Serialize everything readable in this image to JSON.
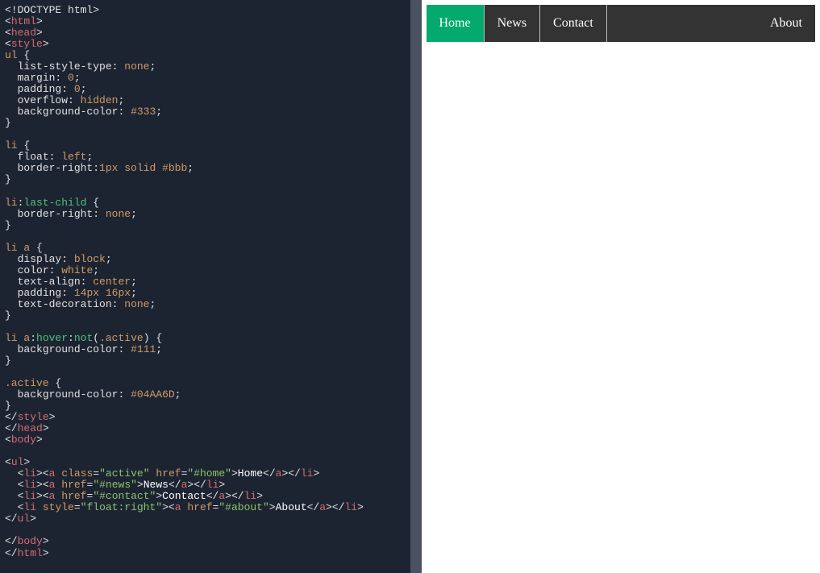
{
  "code": {
    "lines": [
      [
        [
          "tok-angle",
          "<!"
        ],
        [
          "tok-doctype",
          "DOCTYPE html"
        ],
        [
          "tok-angle",
          ">"
        ]
      ],
      [
        [
          "tok-angle",
          "<"
        ],
        [
          "tok-tag",
          "html"
        ],
        [
          "tok-angle",
          ">"
        ]
      ],
      [
        [
          "tok-angle",
          "<"
        ],
        [
          "tok-tag",
          "head"
        ],
        [
          "tok-angle",
          ">"
        ]
      ],
      [
        [
          "tok-angle",
          "<"
        ],
        [
          "tok-tag",
          "style"
        ],
        [
          "tok-angle",
          ">"
        ]
      ],
      [
        [
          "tok-sel",
          "ul"
        ],
        [
          "tok-text",
          " "
        ],
        [
          "tok-brace",
          "{"
        ]
      ],
      [
        [
          "tok-text",
          "  "
        ],
        [
          "tok-prop",
          "list-style-type"
        ],
        [
          "tok-punc",
          ":"
        ],
        [
          "tok-text",
          " "
        ],
        [
          "tok-val",
          "none"
        ],
        [
          "tok-punc",
          ";"
        ]
      ],
      [
        [
          "tok-text",
          "  "
        ],
        [
          "tok-prop",
          "margin"
        ],
        [
          "tok-punc",
          ":"
        ],
        [
          "tok-text",
          " "
        ],
        [
          "tok-val",
          "0"
        ],
        [
          "tok-punc",
          ";"
        ]
      ],
      [
        [
          "tok-text",
          "  "
        ],
        [
          "tok-prop",
          "padding"
        ],
        [
          "tok-punc",
          ":"
        ],
        [
          "tok-text",
          " "
        ],
        [
          "tok-val",
          "0"
        ],
        [
          "tok-punc",
          ";"
        ]
      ],
      [
        [
          "tok-text",
          "  "
        ],
        [
          "tok-prop",
          "overflow"
        ],
        [
          "tok-punc",
          ":"
        ],
        [
          "tok-text",
          " "
        ],
        [
          "tok-val",
          "hidden"
        ],
        [
          "tok-punc",
          ";"
        ]
      ],
      [
        [
          "tok-text",
          "  "
        ],
        [
          "tok-prop",
          "background-color"
        ],
        [
          "tok-punc",
          ":"
        ],
        [
          "tok-text",
          " "
        ],
        [
          "tok-hex",
          "#333"
        ],
        [
          "tok-punc",
          ";"
        ]
      ],
      [
        [
          "tok-brace",
          "}"
        ]
      ],
      [
        [
          "tok-text",
          ""
        ]
      ],
      [
        [
          "tok-sel",
          "li"
        ],
        [
          "tok-text",
          " "
        ],
        [
          "tok-brace",
          "{"
        ]
      ],
      [
        [
          "tok-text",
          "  "
        ],
        [
          "tok-prop",
          "float"
        ],
        [
          "tok-punc",
          ":"
        ],
        [
          "tok-text",
          " "
        ],
        [
          "tok-val",
          "left"
        ],
        [
          "tok-punc",
          ";"
        ]
      ],
      [
        [
          "tok-text",
          "  "
        ],
        [
          "tok-prop",
          "border-right"
        ],
        [
          "tok-punc",
          ":"
        ],
        [
          "tok-val",
          "1px solid "
        ],
        [
          "tok-hex",
          "#bbb"
        ],
        [
          "tok-punc",
          ";"
        ]
      ],
      [
        [
          "tok-brace",
          "}"
        ]
      ],
      [
        [
          "tok-text",
          ""
        ]
      ],
      [
        [
          "tok-sel",
          "li"
        ],
        [
          "tok-punc",
          ":"
        ],
        [
          "tok-pseudo",
          "last-child"
        ],
        [
          "tok-text",
          " "
        ],
        [
          "tok-brace",
          "{"
        ]
      ],
      [
        [
          "tok-text",
          "  "
        ],
        [
          "tok-prop",
          "border-right"
        ],
        [
          "tok-punc",
          ":"
        ],
        [
          "tok-text",
          " "
        ],
        [
          "tok-val",
          "none"
        ],
        [
          "tok-punc",
          ";"
        ]
      ],
      [
        [
          "tok-brace",
          "}"
        ]
      ],
      [
        [
          "tok-text",
          ""
        ]
      ],
      [
        [
          "tok-sel",
          "li a"
        ],
        [
          "tok-text",
          " "
        ],
        [
          "tok-brace",
          "{"
        ]
      ],
      [
        [
          "tok-text",
          "  "
        ],
        [
          "tok-prop",
          "display"
        ],
        [
          "tok-punc",
          ":"
        ],
        [
          "tok-text",
          " "
        ],
        [
          "tok-val",
          "block"
        ],
        [
          "tok-punc",
          ";"
        ]
      ],
      [
        [
          "tok-text",
          "  "
        ],
        [
          "tok-prop",
          "color"
        ],
        [
          "tok-punc",
          ":"
        ],
        [
          "tok-text",
          " "
        ],
        [
          "tok-val",
          "white"
        ],
        [
          "tok-punc",
          ";"
        ]
      ],
      [
        [
          "tok-text",
          "  "
        ],
        [
          "tok-prop",
          "text-align"
        ],
        [
          "tok-punc",
          ":"
        ],
        [
          "tok-text",
          " "
        ],
        [
          "tok-val",
          "center"
        ],
        [
          "tok-punc",
          ";"
        ]
      ],
      [
        [
          "tok-text",
          "  "
        ],
        [
          "tok-prop",
          "padding"
        ],
        [
          "tok-punc",
          ":"
        ],
        [
          "tok-text",
          " "
        ],
        [
          "tok-val",
          "14px 16px"
        ],
        [
          "tok-punc",
          ";"
        ]
      ],
      [
        [
          "tok-text",
          "  "
        ],
        [
          "tok-prop",
          "text-decoration"
        ],
        [
          "tok-punc",
          ":"
        ],
        [
          "tok-text",
          " "
        ],
        [
          "tok-val",
          "none"
        ],
        [
          "tok-punc",
          ";"
        ]
      ],
      [
        [
          "tok-brace",
          "}"
        ]
      ],
      [
        [
          "tok-text",
          ""
        ]
      ],
      [
        [
          "tok-sel",
          "li a"
        ],
        [
          "tok-punc",
          ":"
        ],
        [
          "tok-pseudo",
          "hover"
        ],
        [
          "tok-punc",
          ":"
        ],
        [
          "tok-pseudo",
          "not"
        ],
        [
          "tok-punc",
          "("
        ],
        [
          "tok-class",
          ".active"
        ],
        [
          "tok-punc",
          ")"
        ],
        [
          "tok-text",
          " "
        ],
        [
          "tok-brace",
          "{"
        ]
      ],
      [
        [
          "tok-text",
          "  "
        ],
        [
          "tok-prop",
          "background-color"
        ],
        [
          "tok-punc",
          ":"
        ],
        [
          "tok-text",
          " "
        ],
        [
          "tok-hex",
          "#111"
        ],
        [
          "tok-punc",
          ";"
        ]
      ],
      [
        [
          "tok-brace",
          "}"
        ]
      ],
      [
        [
          "tok-text",
          ""
        ]
      ],
      [
        [
          "tok-class",
          ".active"
        ],
        [
          "tok-text",
          " "
        ],
        [
          "tok-brace",
          "{"
        ]
      ],
      [
        [
          "tok-text",
          "  "
        ],
        [
          "tok-prop",
          "background-color"
        ],
        [
          "tok-punc",
          ":"
        ],
        [
          "tok-text",
          " "
        ],
        [
          "tok-hex",
          "#04AA6D"
        ],
        [
          "tok-punc",
          ";"
        ]
      ],
      [
        [
          "tok-brace",
          "}"
        ]
      ],
      [
        [
          "tok-angle",
          "</"
        ],
        [
          "tok-tag",
          "style"
        ],
        [
          "tok-angle",
          ">"
        ]
      ],
      [
        [
          "tok-angle",
          "</"
        ],
        [
          "tok-tag",
          "head"
        ],
        [
          "tok-angle",
          ">"
        ]
      ],
      [
        [
          "tok-angle",
          "<"
        ],
        [
          "tok-tag",
          "body"
        ],
        [
          "tok-angle",
          ">"
        ]
      ],
      [
        [
          "tok-text",
          ""
        ]
      ],
      [
        [
          "tok-angle",
          "<"
        ],
        [
          "tok-tag",
          "ul"
        ],
        [
          "tok-angle",
          ">"
        ]
      ],
      [
        [
          "tok-text",
          "  "
        ],
        [
          "tok-angle",
          "<"
        ],
        [
          "tok-tag",
          "li"
        ],
        [
          "tok-angle",
          ">"
        ],
        [
          "tok-angle",
          "<"
        ],
        [
          "tok-tag",
          "a"
        ],
        [
          "tok-text",
          " "
        ],
        [
          "tok-attr",
          "class"
        ],
        [
          "tok-punc",
          "="
        ],
        [
          "tok-str",
          "\"active\""
        ],
        [
          "tok-text",
          " "
        ],
        [
          "tok-attr",
          "href"
        ],
        [
          "tok-punc",
          "="
        ],
        [
          "tok-str",
          "\"#home\""
        ],
        [
          "tok-angle",
          ">"
        ],
        [
          "tok-strw",
          "Home"
        ],
        [
          "tok-angle",
          "</"
        ],
        [
          "tok-tag",
          "a"
        ],
        [
          "tok-angle",
          ">"
        ],
        [
          "tok-angle",
          "</"
        ],
        [
          "tok-tag",
          "li"
        ],
        [
          "tok-angle",
          ">"
        ]
      ],
      [
        [
          "tok-text",
          "  "
        ],
        [
          "tok-angle",
          "<"
        ],
        [
          "tok-tag",
          "li"
        ],
        [
          "tok-angle",
          ">"
        ],
        [
          "tok-angle",
          "<"
        ],
        [
          "tok-tag",
          "a"
        ],
        [
          "tok-text",
          " "
        ],
        [
          "tok-attr",
          "href"
        ],
        [
          "tok-punc",
          "="
        ],
        [
          "tok-str",
          "\"#news\""
        ],
        [
          "tok-angle",
          ">"
        ],
        [
          "tok-strw",
          "News"
        ],
        [
          "tok-angle",
          "</"
        ],
        [
          "tok-tag",
          "a"
        ],
        [
          "tok-angle",
          ">"
        ],
        [
          "tok-angle",
          "</"
        ],
        [
          "tok-tag",
          "li"
        ],
        [
          "tok-angle",
          ">"
        ]
      ],
      [
        [
          "tok-text",
          "  "
        ],
        [
          "tok-angle",
          "<"
        ],
        [
          "tok-tag",
          "li"
        ],
        [
          "tok-angle",
          ">"
        ],
        [
          "tok-angle",
          "<"
        ],
        [
          "tok-tag",
          "a"
        ],
        [
          "tok-text",
          " "
        ],
        [
          "tok-attr",
          "href"
        ],
        [
          "tok-punc",
          "="
        ],
        [
          "tok-str",
          "\"#contact\""
        ],
        [
          "tok-angle",
          ">"
        ],
        [
          "tok-strw",
          "Contact"
        ],
        [
          "tok-angle",
          "</"
        ],
        [
          "tok-tag",
          "a"
        ],
        [
          "tok-angle",
          ">"
        ],
        [
          "tok-angle",
          "</"
        ],
        [
          "tok-tag",
          "li"
        ],
        [
          "tok-angle",
          ">"
        ]
      ],
      [
        [
          "tok-text",
          "  "
        ],
        [
          "tok-angle",
          "<"
        ],
        [
          "tok-tag",
          "li"
        ],
        [
          "tok-text",
          " "
        ],
        [
          "tok-attr",
          "style"
        ],
        [
          "tok-punc",
          "="
        ],
        [
          "tok-str",
          "\"float:right\""
        ],
        [
          "tok-angle",
          ">"
        ],
        [
          "tok-angle",
          "<"
        ],
        [
          "tok-tag",
          "a"
        ],
        [
          "tok-text",
          " "
        ],
        [
          "tok-attr",
          "href"
        ],
        [
          "tok-punc",
          "="
        ],
        [
          "tok-str",
          "\"#about\""
        ],
        [
          "tok-angle",
          ">"
        ],
        [
          "tok-strw",
          "About"
        ],
        [
          "tok-angle",
          "</"
        ],
        [
          "tok-tag",
          "a"
        ],
        [
          "tok-angle",
          ">"
        ],
        [
          "tok-angle",
          "</"
        ],
        [
          "tok-tag",
          "li"
        ],
        [
          "tok-angle",
          ">"
        ]
      ],
      [
        [
          "tok-angle",
          "</"
        ],
        [
          "tok-tag",
          "ul"
        ],
        [
          "tok-angle",
          ">"
        ]
      ],
      [
        [
          "tok-text",
          ""
        ]
      ],
      [
        [
          "tok-angle",
          "</"
        ],
        [
          "tok-tag",
          "body"
        ],
        [
          "tok-angle",
          ">"
        ]
      ],
      [
        [
          "tok-angle",
          "</"
        ],
        [
          "tok-tag",
          "html"
        ],
        [
          "tok-angle",
          ">"
        ]
      ]
    ]
  },
  "preview": {
    "nav": {
      "home": "Home",
      "news": "News",
      "contact": "Contact",
      "about": "About"
    }
  }
}
